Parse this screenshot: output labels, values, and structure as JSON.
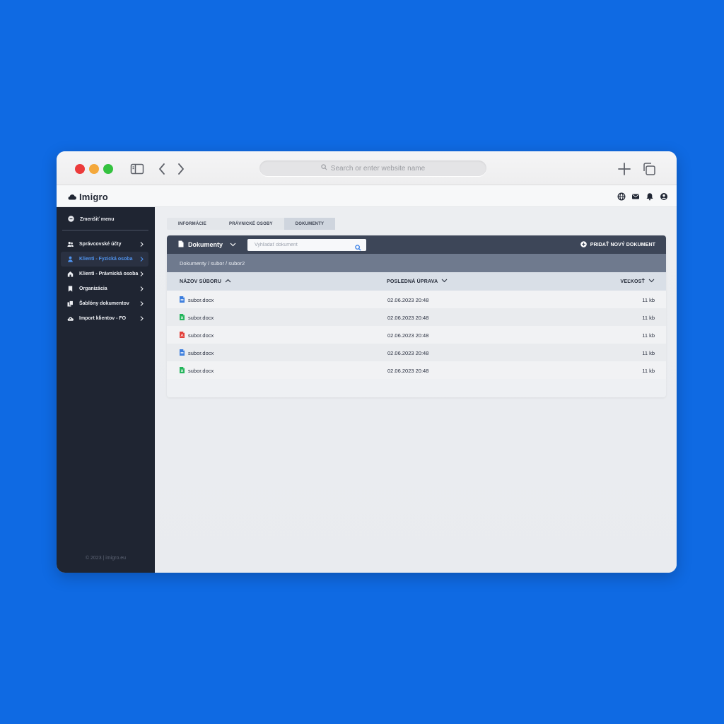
{
  "browser": {
    "address_placeholder": "Search or enter website name"
  },
  "app": {
    "name": "Imigro"
  },
  "sidebar": {
    "shrink_label": "Zmenšiť menu",
    "items": [
      {
        "label": "Správcovské účty",
        "icon": "users-icon",
        "active": false
      },
      {
        "label": "Klienti - Fyzická osoba",
        "icon": "person-icon",
        "active": true
      },
      {
        "label": "Klienti - Právnická osoba",
        "icon": "building-icon",
        "active": false
      },
      {
        "label": "Organizácia",
        "icon": "bookmark-icon",
        "active": false
      },
      {
        "label": "Šablóny dokumentov",
        "icon": "templates-icon",
        "active": false
      },
      {
        "label": "Import klientov - FO",
        "icon": "cloud-upload-icon",
        "active": false
      }
    ],
    "copyright": "© 2023 | imigro.eu"
  },
  "tabs": [
    {
      "label": "INFORMÁCIE",
      "active": false
    },
    {
      "label": "PRÁVNICKÉ OSOBY",
      "active": false
    },
    {
      "label": "DOKUMENTY",
      "active": true
    }
  ],
  "documents": {
    "title": "Dokumenty",
    "search_placeholder": "Vyhľadať dokument",
    "add_label": "PRIDAŤ NOVÝ DOKUMENT",
    "breadcrumb": "Dokumenty / subor / subor2",
    "columns": {
      "name": "NÁZOV SÚBORU",
      "date": "POSLEDNÁ ÚPRAVA",
      "size": "VEĽKOSŤ"
    },
    "rows": [
      {
        "name": "subor.docx",
        "date": "02.06.2023 20:48",
        "size": "11 kb",
        "icon": "word-file-icon",
        "color": "#3b7ddd"
      },
      {
        "name": "subor.docx",
        "date": "02.06.2023 20:48",
        "size": "11 kb",
        "icon": "excel-file-icon",
        "color": "#22b45a"
      },
      {
        "name": "subor.docx",
        "date": "02.06.2023 20:48",
        "size": "11 kb",
        "icon": "pdf-file-icon",
        "color": "#e2403b"
      },
      {
        "name": "subor.docx",
        "date": "02.06.2023 20:48",
        "size": "11 kb",
        "icon": "word-file-icon",
        "color": "#3b7ddd"
      },
      {
        "name": "subor.docx",
        "date": "02.06.2023 20:48",
        "size": "11 kb",
        "icon": "excel-file-icon",
        "color": "#22b45a"
      }
    ]
  },
  "colors": {
    "background": "#0f6ae3",
    "sidebar": "#1f2532",
    "active_nav": "#4f93ee",
    "panel_header": "#3d4658",
    "breadcrumb_bar": "#6f7a8e"
  }
}
